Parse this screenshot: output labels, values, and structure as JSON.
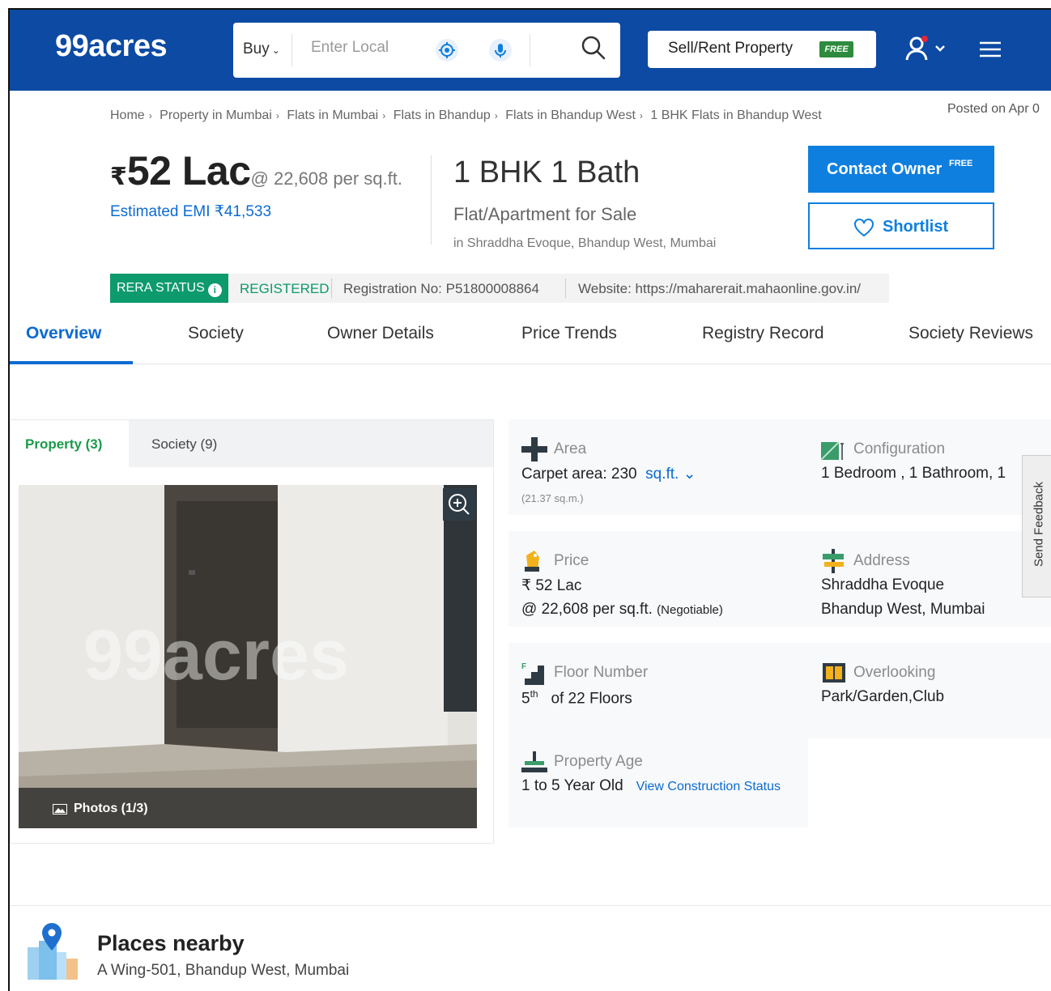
{
  "header": {
    "logo": "99acres",
    "buy_label": "Buy",
    "search_placeholder": "Enter Local",
    "sell_label": "Sell/Rent Property",
    "sell_badge": "FREE"
  },
  "breadcrumb": {
    "items": [
      "Home",
      "Property in Mumbai",
      "Flats in Mumbai",
      "Flats in Bhandup",
      "Flats in Bhandup West",
      "1 BHK Flats in Bhandup West"
    ],
    "posted": "Posted on Apr 0"
  },
  "listing": {
    "currency": "₹",
    "price": "52 Lac",
    "per_sqft": "@ 22,608 per sq.ft.",
    "emi": "Estimated EMI ₹41,533",
    "config": "1 BHK 1 Bath",
    "type": "Flat/Apartment for Sale",
    "location": "in Shraddha Evoque, Bhandup West, Mumbai",
    "contact_label": "Contact Owner",
    "contact_badge": "FREE",
    "shortlist_label": "Shortlist"
  },
  "rera": {
    "badge": "RERA STATUS",
    "status": "REGISTERED",
    "reg_no": "Registration No: P51800008864",
    "website": "Website: https://maharerait.mahaonline.gov.in/"
  },
  "tabs": [
    "Overview",
    "Society",
    "Owner Details",
    "Price Trends",
    "Registry Record",
    "Society Reviews"
  ],
  "gallery": {
    "tab_property": "Property (3)",
    "tab_society": "Society (9)",
    "photos_label": "Photos (1/3)",
    "watermark": "99acres"
  },
  "details": {
    "area": {
      "title": "Area",
      "value": "Carpet area: 230",
      "unit": "sq.ft.",
      "sub": "(21.37 sq.m.)"
    },
    "configuration": {
      "title": "Configuration",
      "value": "1 Bedroom , 1 Bathroom, 1"
    },
    "price": {
      "title": "Price",
      "value": "₹ 52 Lac",
      "per": "@ 22,608 per sq.ft.",
      "note": "(Negotiable)"
    },
    "address": {
      "title": "Address",
      "line1": "Shraddha Evoque",
      "line2": "Bhandup West, Mumbai"
    },
    "floor": {
      "title": "Floor Number",
      "num": "5",
      "sup": "th",
      "of": "of 22 Floors"
    },
    "overlooking": {
      "title": "Overlooking",
      "value": "Park/Garden,Club"
    },
    "age": {
      "title": "Property Age",
      "value": "1 to 5 Year Old",
      "link": "View Construction Status"
    }
  },
  "feedback_label": "Send Feedback",
  "places": {
    "title": "Places nearby",
    "subtitle": "A Wing-501, Bhandup West, Mumbai"
  },
  "colors": {
    "brand_blue": "#0c4aa3",
    "link_blue": "#0c6bd1",
    "rera_green": "#0d9a6c",
    "tab_green": "#1b9a4b"
  }
}
